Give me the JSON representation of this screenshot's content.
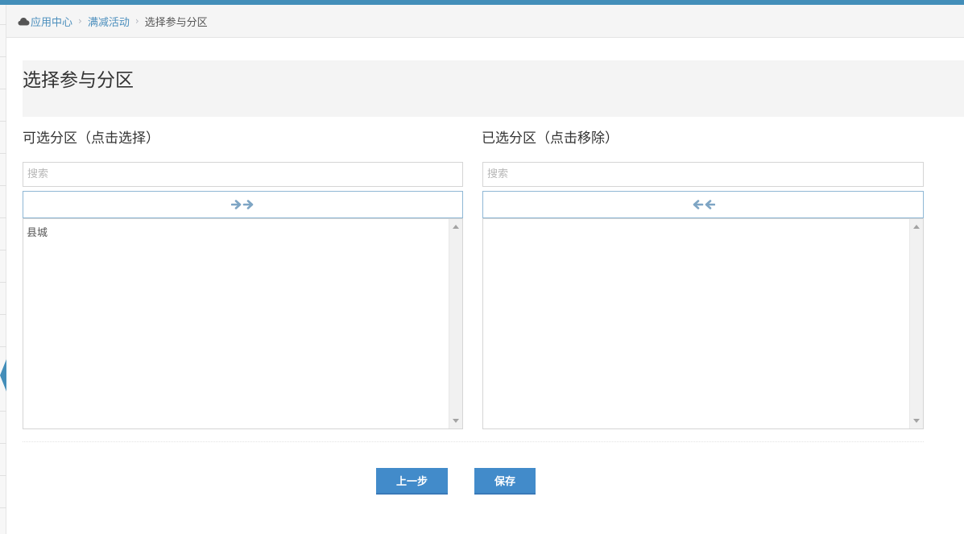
{
  "breadcrumbs": {
    "items": [
      {
        "label": "应用中心",
        "link": true
      },
      {
        "label": "满减活动",
        "link": true
      },
      {
        "label": "选择参与分区",
        "link": false
      }
    ]
  },
  "page": {
    "title": "选择参与分区"
  },
  "available": {
    "title": "可选分区（点击选择）",
    "search_placeholder": "搜索",
    "move_icon": "double-arrow-right-icon",
    "options": [
      "县城"
    ]
  },
  "selected": {
    "title": "已选分区（点击移除）",
    "search_placeholder": "搜索",
    "move_icon": "double-arrow-left-icon",
    "options": []
  },
  "actions": {
    "prev_label": "上一步",
    "save_label": "保存"
  },
  "colors": {
    "accent": "#438eb9",
    "link": "#4c8fbd",
    "primary_button": "#428bca",
    "arrow_icon": "#7ea5c4"
  }
}
